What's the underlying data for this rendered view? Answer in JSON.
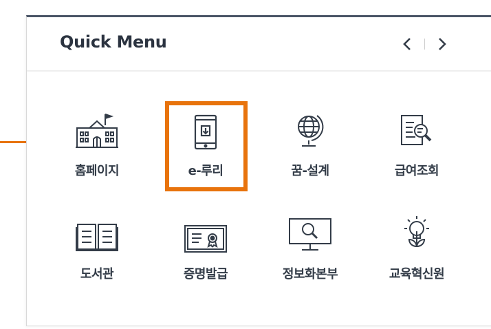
{
  "quick_menu": {
    "title": "Quick Menu",
    "prev_icon": "chevron-left-icon",
    "next_icon": "chevron-right-icon",
    "items": [
      {
        "label": "홈페이지",
        "icon": "school-building-icon"
      },
      {
        "label": "e-루리",
        "icon": "tablet-download-icon"
      },
      {
        "label": "꿈-설계",
        "icon": "globe-icon"
      },
      {
        "label": "급여조회",
        "icon": "document-search-icon"
      },
      {
        "label": "도서관",
        "icon": "open-book-icon"
      },
      {
        "label": "증명발급",
        "icon": "certificate-icon"
      },
      {
        "label": "정보화본부",
        "icon": "monitor-search-icon"
      },
      {
        "label": "교육혁신원",
        "icon": "lightbulb-idea-icon"
      }
    ]
  },
  "highlight": {
    "target": "e-루리",
    "color": "#e8730c"
  },
  "colors": {
    "icon": "#333c48",
    "header_border": "#4a5566",
    "accent": "#e8730c"
  }
}
